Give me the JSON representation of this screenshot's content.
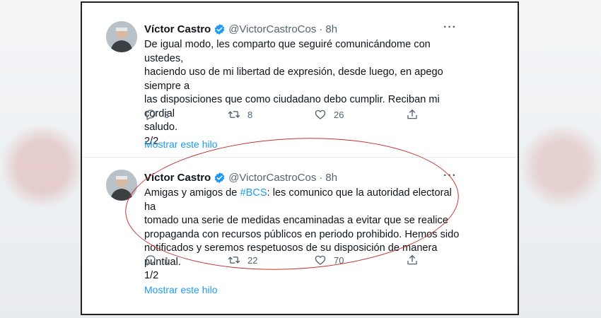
{
  "tweets": [
    {
      "display_name": "Víctor Castro",
      "handle": "@VictorCastroCos",
      "time": "8h",
      "text_lines": [
        "De igual modo, les comparto que seguiré comunicándome con ustedes,",
        "haciendo uso de mi libertad de expresión, desde luego, en apego siempre a",
        "las disposiciones que como ciudadano debo cumplir. Reciban mi cordial",
        "saludo.",
        "2/2"
      ],
      "replies": "3",
      "retweets": "8",
      "likes": "26",
      "show_thread": "Mostrar este hilo"
    },
    {
      "display_name": "Víctor Castro",
      "handle": "@VictorCastroCos",
      "time": "8h",
      "text_prefix": "Amigas y amigos de ",
      "hashtag": "#BCS",
      "text_suffix": ": les comunico que la autoridad electoral ha",
      "text_lines": [
        "tomado una serie de medidas encaminadas a evitar que se realice",
        "propaganda con recursos públicos en periodo prohibido. Hemos sido",
        "notificados y seremos respetuosos de su disposición de manera puntual.",
        "1/2"
      ],
      "replies": "1",
      "retweets": "22",
      "likes": "70",
      "show_thread": "Mostrar este hilo"
    }
  ],
  "icons": {
    "more": "more-horizontal-icon",
    "reply": "reply-icon",
    "retweet": "retweet-icon",
    "like": "heart-icon",
    "share": "share-icon",
    "verified": "verified-badge-icon"
  },
  "colors": {
    "link": "#1d9bf0",
    "verified": "#1d9bf0",
    "annotation": "#c8322f"
  }
}
